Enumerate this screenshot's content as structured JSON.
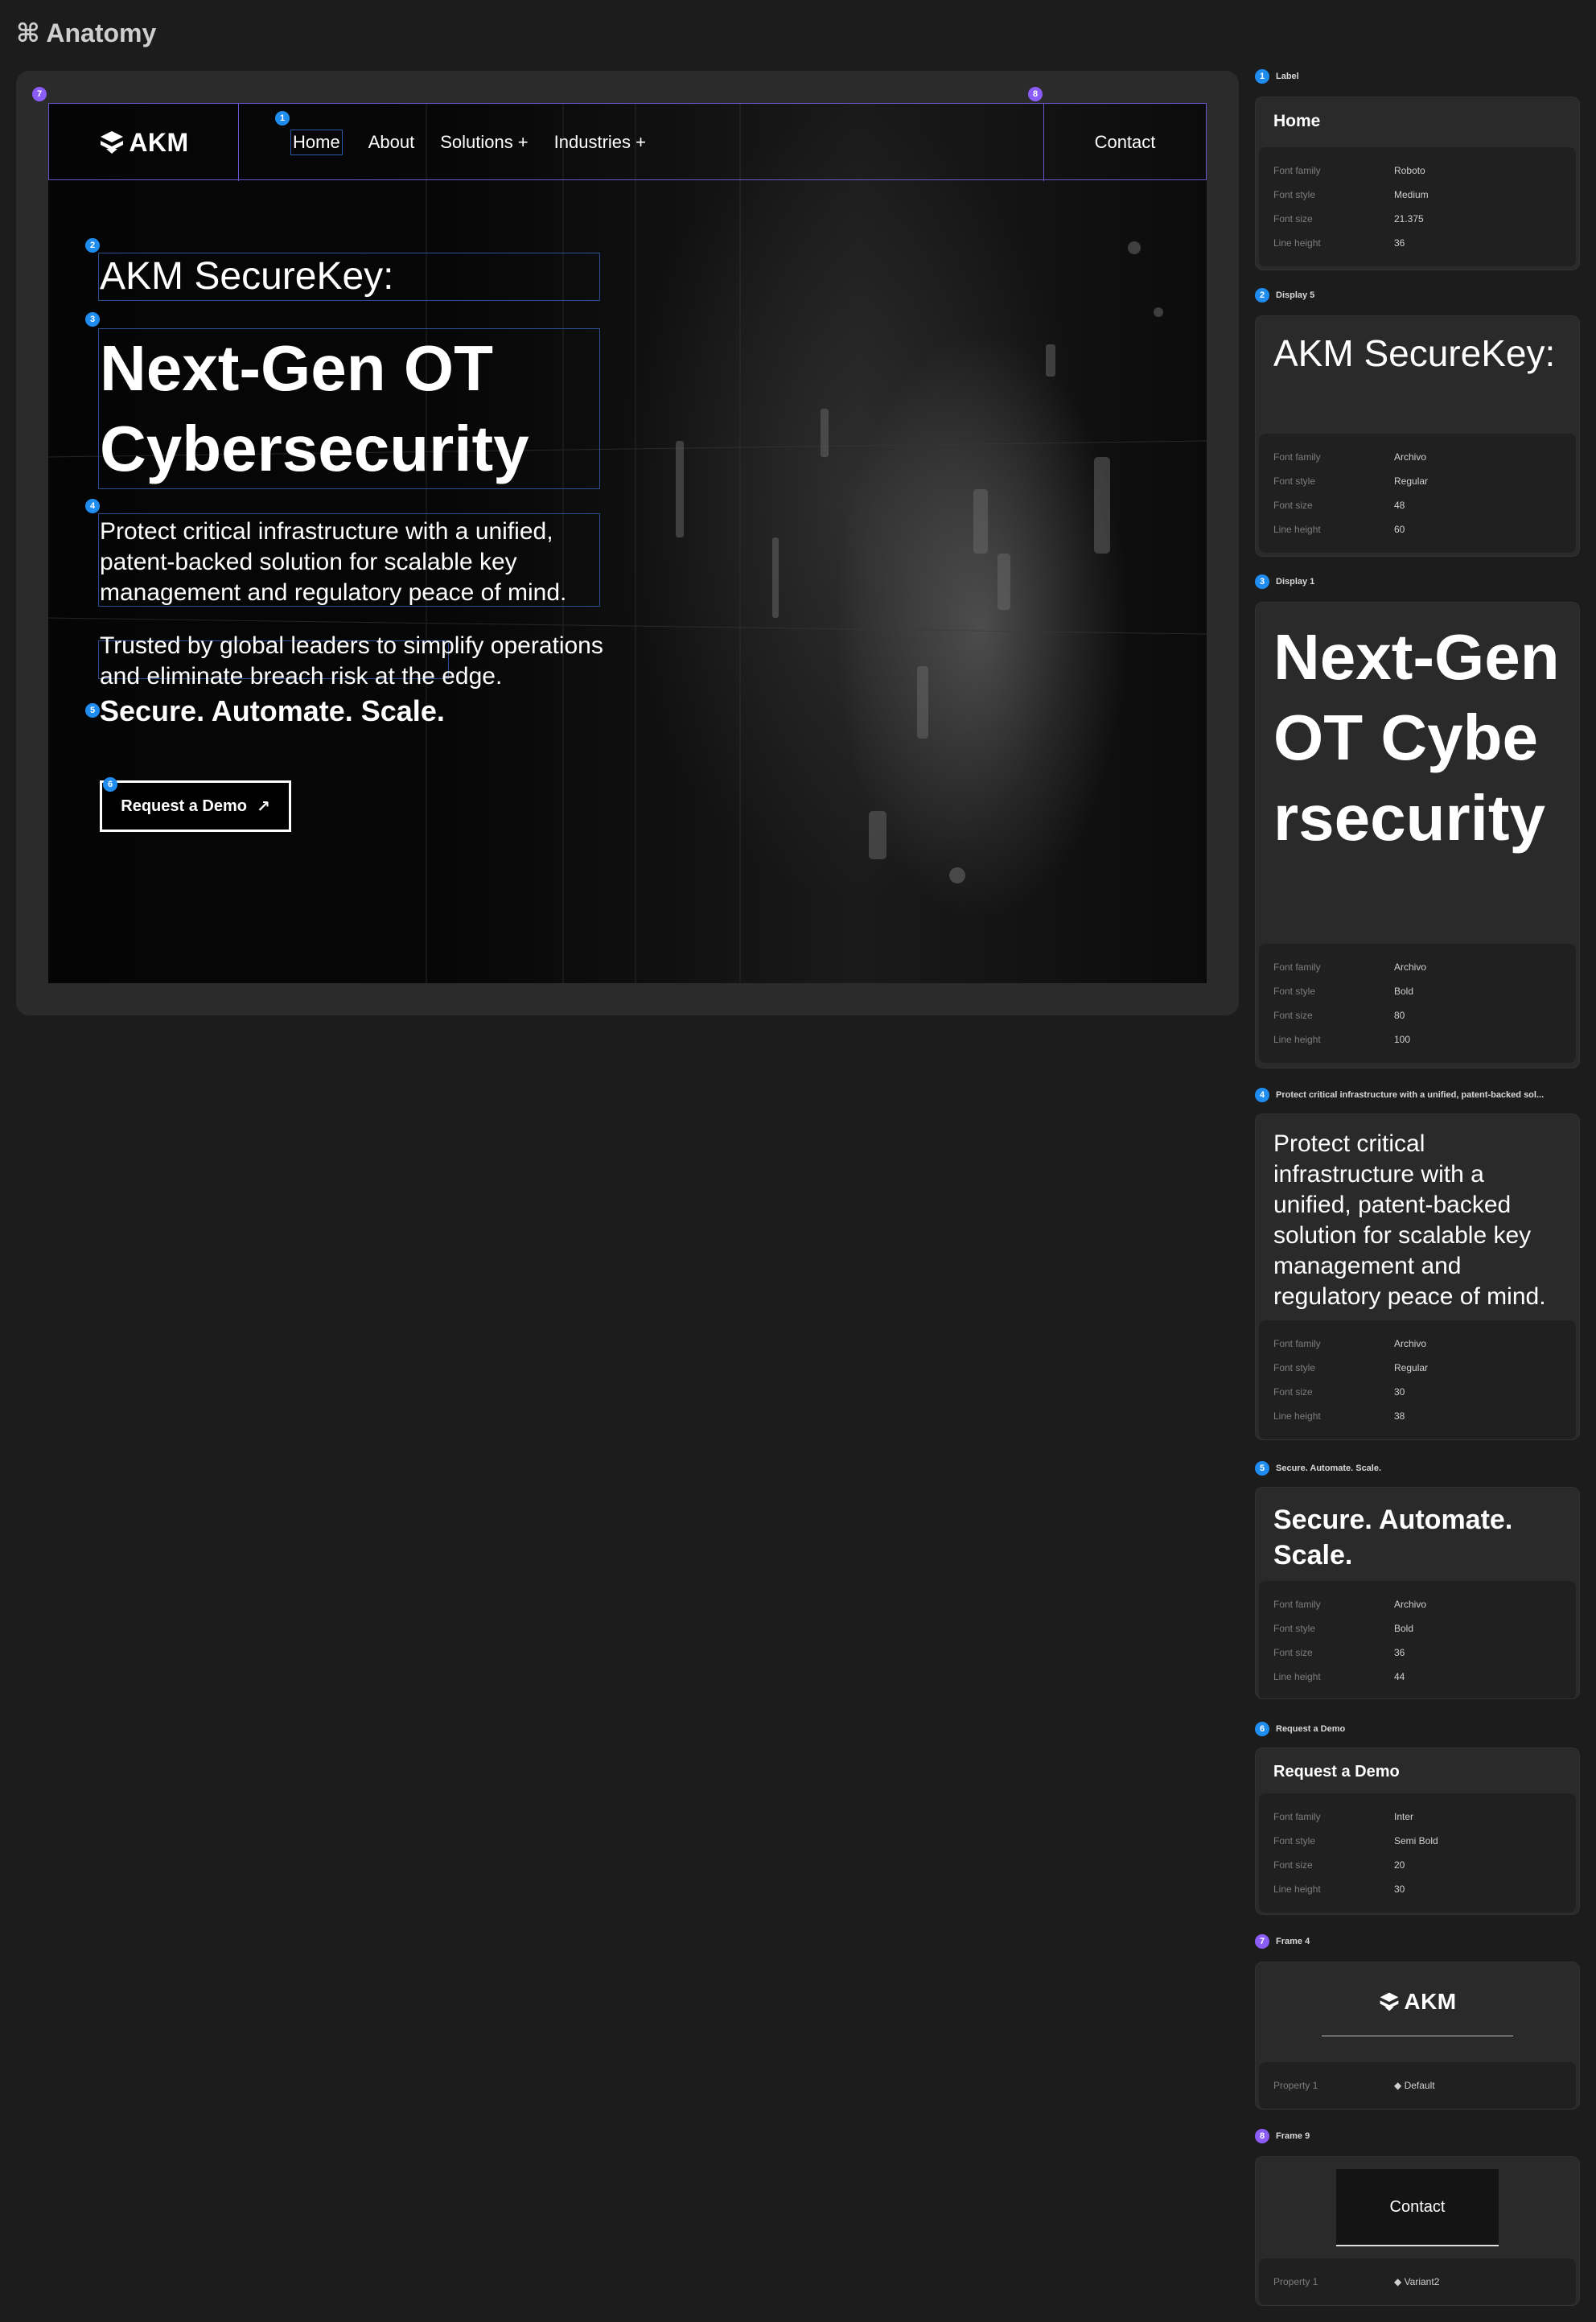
{
  "header": {
    "title": "⌘ Anatomy"
  },
  "preview": {
    "nav": {
      "logo_text": "AKM",
      "links": [
        "Home",
        "About",
        "Solutions +",
        "Industries +"
      ],
      "contact": "Contact"
    },
    "kicker": "AKM SecureKey:",
    "display_line1": "Next-Gen OT",
    "display_line2": "Cybersecurity",
    "body": "Protect critical infrastructure with a unified, patent-backed solution for scalable key management and regulatory peace of mind.",
    "body2": "Trusted by global leaders to simplify operations and eliminate breach risk at the edge.",
    "tagline": "Secure. Automate. Scale.",
    "cta": "Request a Demo",
    "badges": [
      "1",
      "2",
      "3",
      "4",
      "5",
      "6",
      "7",
      "8"
    ]
  },
  "specs": [
    {
      "num": "1",
      "color": "blue",
      "name": "Label",
      "preview": "Home",
      "props": [
        [
          "Font family",
          "Roboto"
        ],
        [
          "Font style",
          "Medium"
        ],
        [
          "Font size",
          "21.375"
        ],
        [
          "Line height",
          "36"
        ]
      ]
    },
    {
      "num": "2",
      "color": "blue",
      "name": "Display 5",
      "preview": "AKM SecureKey:",
      "props": [
        [
          "Font family",
          "Archivo"
        ],
        [
          "Font style",
          "Regular"
        ],
        [
          "Font size",
          "48"
        ],
        [
          "Line height",
          "60"
        ]
      ]
    },
    {
      "num": "3",
      "color": "blue",
      "name": "Display 1",
      "preview": "Next-Gen OT Cybersecurity",
      "props": [
        [
          "Font family",
          "Archivo"
        ],
        [
          "Font style",
          "Bold"
        ],
        [
          "Font size",
          "80"
        ],
        [
          "Line height",
          "100"
        ]
      ]
    },
    {
      "num": "4",
      "color": "blue",
      "name": "Protect critical infrastructure with a unified, patent-backed sol...",
      "preview": "Protect critical infrastructure with a unified, patent-backed solution for scalable key management and regulatory peace of mind.",
      "props": [
        [
          "Font family",
          "Archivo"
        ],
        [
          "Font style",
          "Regular"
        ],
        [
          "Font size",
          "30"
        ],
        [
          "Line height",
          "38"
        ]
      ]
    },
    {
      "num": "5",
      "color": "blue",
      "name": "Secure. Automate. Scale.",
      "preview": "Secure. Automate. Scale.",
      "props": [
        [
          "Font family",
          "Archivo"
        ],
        [
          "Font style",
          "Bold"
        ],
        [
          "Font size",
          "36"
        ],
        [
          "Line height",
          "44"
        ]
      ]
    },
    {
      "num": "6",
      "color": "blue",
      "name": "Request a Demo",
      "preview": "Request a Demo",
      "props": [
        [
          "Font family",
          "Inter"
        ],
        [
          "Font style",
          "Semi Bold"
        ],
        [
          "Font size",
          "20"
        ],
        [
          "Line height",
          "30"
        ]
      ]
    },
    {
      "num": "7",
      "color": "purple",
      "name": "Frame 4",
      "preview": "AKM",
      "props": [
        [
          "Property 1",
          "◆  Default"
        ]
      ]
    },
    {
      "num": "8",
      "color": "purple",
      "name": "Frame 9",
      "preview": "Contact",
      "props": [
        [
          "Property 1",
          "◆  Variant2"
        ]
      ]
    }
  ]
}
